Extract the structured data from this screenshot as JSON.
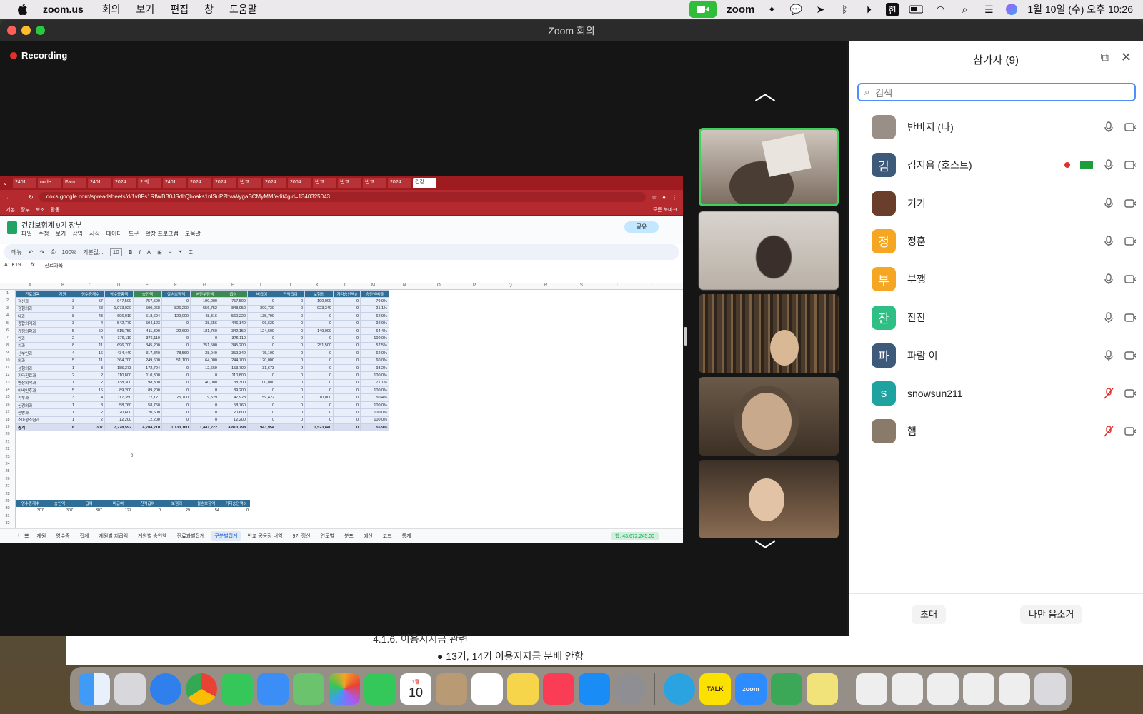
{
  "menubar": {
    "app_name": "zoom.us",
    "menus": [
      "회의",
      "보기",
      "편집",
      "창",
      "도움말"
    ],
    "zoom_logo": "zoom",
    "ime": "한",
    "datetime": "1월 10일 (수) 오후 10:26"
  },
  "window": {
    "title": "Zoom 회의",
    "recording_label": "Recording"
  },
  "share": {
    "tabs": [
      "2401",
      "unde",
      "Fam",
      "2401",
      "2024",
      "2.최",
      "2401",
      "2024",
      "2024",
      "빈교",
      "2024",
      "2004",
      "빈교",
      "빈교",
      "빈교",
      "2024",
      "건강"
    ],
    "url": "docs.google.com/spreadsheets/d/1v8Fs1RfWBB0JSdltQboaks1nlSuP2hwWygaSCMyMM/edit#gid=1340325043",
    "bookmarks": [
      "기본",
      "장부",
      "보조",
      "활동",
      "모든 북마크"
    ],
    "doc_title": "건강보험계 9기 장부",
    "sheet_menus": [
      "파일",
      "수정",
      "보기",
      "삽입",
      "서식",
      "데이터",
      "도구",
      "확장 프로그램",
      "도움말"
    ],
    "share_button": "공유",
    "toolbar": {
      "search": "메뉴",
      "zoom": "100%",
      "font": "기본값...",
      "font_size": "10"
    },
    "cell_ref": "A1:K19",
    "formula": "진료과목",
    "columns": [
      "A",
      "B",
      "C",
      "D",
      "E",
      "F",
      "G",
      "H",
      "I",
      "J",
      "K",
      "L",
      "M",
      "N",
      "O",
      "P",
      "Q",
      "R",
      "S",
      "T",
      "U"
    ],
    "headers": [
      "진료과목",
      "계원",
      "영수증개수",
      "영수증총액",
      "승인액",
      "실손보장액",
      "본인부담액",
      "급여",
      "비급여",
      "진액급여",
      "보험외",
      "기타승인액0",
      "승인액비율"
    ],
    "rows": [
      [
        "정신과",
        "3",
        "57",
        "947,500",
        "757,500",
        "0",
        "190,000",
        "757,500",
        "0",
        "0",
        "190,000",
        "0",
        "79.9%"
      ],
      [
        "정형외과",
        "3",
        "68",
        "1,973,020",
        "590,068",
        "826,200",
        "556,752",
        "848,950",
        "200,730",
        "0",
        "923,340",
        "0",
        "21.1%"
      ],
      [
        "내과",
        "8",
        "43",
        "696,010",
        "518,694",
        "129,000",
        "48,316",
        "560,220",
        "135,790",
        "0",
        "0",
        "0",
        "62.9%"
      ],
      [
        "종합외래과",
        "3",
        "4",
        "542,779",
        "504,123",
        "0",
        "38,656",
        "446,140",
        "96,639",
        "0",
        "0",
        "0",
        "92.9%"
      ],
      [
        "가정의학과",
        "5",
        "59",
        "615,750",
        "411,390",
        "22,600",
        "181,760",
        "342,150",
        "124,600",
        "0",
        "149,000",
        "0",
        "64.4%"
      ],
      [
        "안과",
        "2",
        "4",
        "376,110",
        "376,110",
        "0",
        "0",
        "376,110",
        "0",
        "0",
        "0",
        "0",
        "100.0%"
      ],
      [
        "치과",
        "8",
        "11",
        "696,700",
        "345,200",
        "0",
        "251,500",
        "345,200",
        "0",
        "0",
        "251,500",
        "0",
        "57.5%"
      ],
      [
        "산부인과",
        "4",
        "16",
        "434,440",
        "317,840",
        "78,560",
        "38,040",
        "359,340",
        "75,100",
        "0",
        "0",
        "0",
        "62.0%"
      ],
      [
        "외과",
        "5",
        "11",
        "364,700",
        "249,600",
        "51,100",
        "64,000",
        "244,700",
        "120,000",
        "0",
        "0",
        "0",
        "60.0%"
      ],
      [
        "성형외과",
        "1",
        "3",
        "185,373",
        "172,704",
        "0",
        "12,669",
        "153,700",
        "31,673",
        "0",
        "0",
        "0",
        "93.2%"
      ],
      [
        "기타진료과",
        "2",
        "2",
        "110,800",
        "110,800",
        "0",
        "0",
        "110,800",
        "0",
        "0",
        "0",
        "0",
        "100.0%"
      ],
      [
        "영상의학과",
        "1",
        "2",
        "138,300",
        "98,300",
        "0",
        "40,000",
        "38,300",
        "100,000",
        "0",
        "0",
        "0",
        "71.1%"
      ],
      [
        "이비인후과",
        "5",
        "16",
        "89,200",
        "89,200",
        "0",
        "0",
        "89,200",
        "0",
        "0",
        "0",
        "0",
        "100.0%"
      ],
      [
        "피부과",
        "3",
        "4",
        "117,350",
        "72,121",
        "25,700",
        "19,529",
        "47,928",
        "59,422",
        "0",
        "10,000",
        "0",
        "50.4%"
      ],
      [
        "신경외과",
        "1",
        "3",
        "58,760",
        "58,760",
        "0",
        "0",
        "58,760",
        "0",
        "0",
        "0",
        "0",
        "100.0%"
      ],
      [
        "한방과",
        "1",
        "2",
        "20,600",
        "20,600",
        "0",
        "0",
        "20,600",
        "0",
        "0",
        "0",
        "0",
        "100.0%"
      ],
      [
        "소아청소년과",
        "1",
        "2",
        "12,200",
        "12,200",
        "0",
        "0",
        "12,200",
        "0",
        "0",
        "0",
        "0",
        "100.0%"
      ]
    ],
    "total": [
      "총계",
      "18",
      "307",
      "7,278,592",
      "4,704,210",
      "1,133,160",
      "1,441,222",
      "4,810,798",
      "943,954",
      "0",
      "1,523,840",
      "0",
      "55.9%"
    ],
    "zero_cell": "0",
    "mini_headers": [
      "영수증개수",
      "승인액",
      "급여",
      "비급여",
      "진액급여",
      "보험외",
      "실손보장액",
      "기타승인액0"
    ],
    "mini_values": [
      "307",
      "307",
      "307",
      "127",
      "0",
      "29",
      "54",
      "0"
    ],
    "sheet_tabs": [
      "계원",
      "영수증",
      "집계",
      "계원별 지급액",
      "계원별 승인액",
      "진료과별집계",
      "구분별집계",
      "빈교 공동장 내역",
      "9기 정산",
      "연도별",
      "분포",
      "예산",
      "코드",
      "통계"
    ],
    "active_tab": "구분별집계",
    "sum_chip": "합: 43,672,245.00"
  },
  "panel": {
    "title": "참가자 (9)",
    "search_placeholder": "검색",
    "participants": [
      {
        "name": "반바지 (나)",
        "initial": "",
        "color": "#9a8f86"
      },
      {
        "name": "김지음 (호스트)",
        "initial": "김",
        "color": "#3d5a7a"
      },
      {
        "name": "기기",
        "initial": "",
        "color": "#6a3e2a"
      },
      {
        "name": "정훈",
        "initial": "정",
        "color": "#f5a623"
      },
      {
        "name": "부깽",
        "initial": "부",
        "color": "#f5a623"
      },
      {
        "name": "잔잔",
        "initial": "잔",
        "color": "#2fbf85"
      },
      {
        "name": "파람 이",
        "initial": "파",
        "color": "#3d5a7a"
      },
      {
        "name": "snowsun211",
        "initial": "s",
        "color": "#1fa3a0"
      },
      {
        "name": "햄",
        "initial": "",
        "color": "#8a7a6a"
      }
    ],
    "invite_button": "초대",
    "mute_me_button": "나만 음소거"
  },
  "background_doc": {
    "heading": "4.1.6.   이용지지금 관련",
    "bullet": "●   13기, 14기 이용지지금 분배 안함"
  },
  "dock": {
    "calendar_month": "1월",
    "calendar_day": "10",
    "kakao": "TALK",
    "zoom": "zoom"
  },
  "colors": {
    "accent": "#0b5cff",
    "recording": "#e0302c",
    "active_speaker": "#3fd25a",
    "chrome_red": "#9e1b1f"
  }
}
